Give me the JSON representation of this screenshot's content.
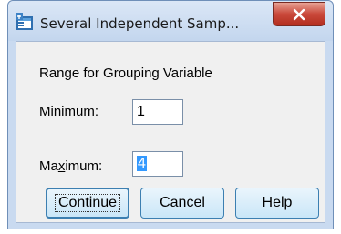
{
  "window": {
    "title": "Several Independent Samp...",
    "close_icon": "close-icon"
  },
  "dialog": {
    "group_label": "Range for Grouping Variable",
    "minimum": {
      "label_prefix": "Mi",
      "label_mnemonic": "n",
      "label_suffix": "imum:",
      "value": "1"
    },
    "maximum": {
      "label_prefix": "Ma",
      "label_mnemonic": "x",
      "label_suffix": "imum:",
      "value": "4"
    },
    "buttons": {
      "continue": "Continue",
      "cancel": "Cancel",
      "help": "Help"
    }
  },
  "colors": {
    "accent": "#3c7fb1",
    "selection": "#3399ff",
    "close": "#c9483a"
  }
}
